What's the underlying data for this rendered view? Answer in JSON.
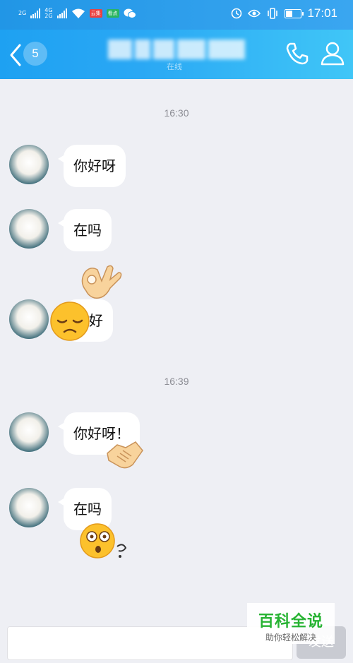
{
  "statusbar": {
    "net1": "2G",
    "net2": "4G",
    "net3": "2G",
    "app1": "云集",
    "app2": "看点",
    "time": "17:01",
    "battery_percent": 45
  },
  "header": {
    "unread_count": "5",
    "subtitle": "在线",
    "icons": [
      "back-arrow-icon",
      "phone-icon",
      "contact-icon"
    ]
  },
  "messages": [
    {
      "type": "time",
      "text": "16:30"
    },
    {
      "type": "msg",
      "text": "你好呀"
    },
    {
      "type": "msg",
      "text": "在吗"
    },
    {
      "type": "msg",
      "text": "好",
      "stickers": [
        "ok-hand-sticker",
        "pensive-face-sticker"
      ]
    },
    {
      "type": "time",
      "text": "16:39"
    },
    {
      "type": "msg",
      "text": "你好呀！",
      "stickers": [
        "handshake-sticker"
      ]
    },
    {
      "type": "msg",
      "text": "在吗",
      "stickers": [
        "shocked-face-sticker"
      ]
    }
  ],
  "input": {
    "send_label": "发送"
  },
  "watermark": {
    "title": "百科全说",
    "subtitle": "助你轻松解决"
  },
  "colors": {
    "header": "#2aa8f4",
    "bg": "#eeeff4",
    "watermark": "#27b333"
  }
}
